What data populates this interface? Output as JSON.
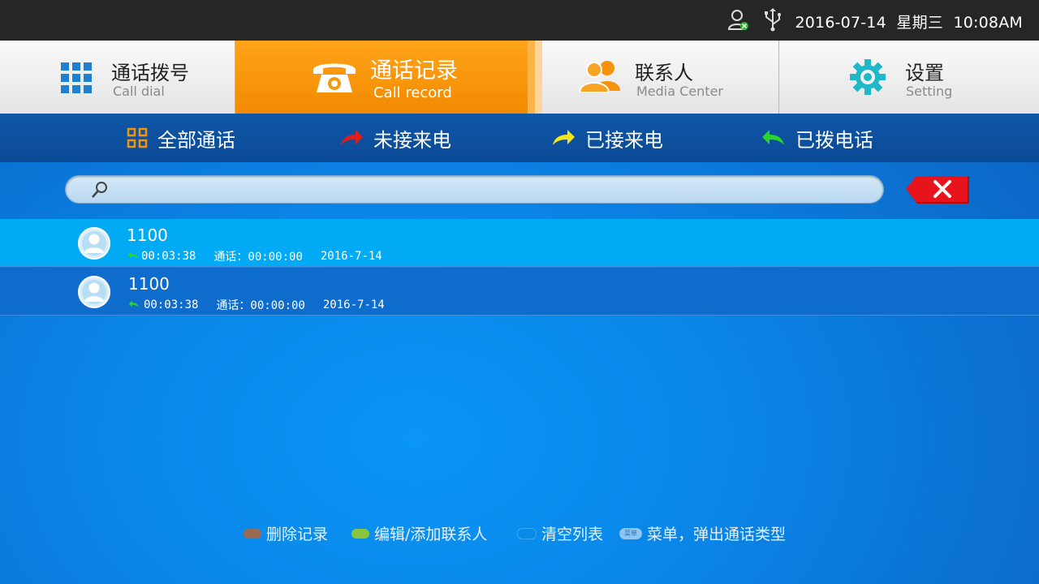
{
  "status": {
    "datetime": "2016-07-14  星期三  10:08AM",
    "icons": [
      "user-status-icon",
      "usb-icon"
    ]
  },
  "tabs": [
    {
      "label": "通话拨号",
      "sub": "Call dial",
      "icon": "dialpad-icon",
      "active": false
    },
    {
      "label": "通话记录",
      "sub": "Call record",
      "icon": "telephone-icon",
      "active": true
    },
    {
      "label": "联系人",
      "sub": "Media Center",
      "icon": "contacts-icon",
      "active": false
    },
    {
      "label": "设置",
      "sub": "Setting",
      "icon": "gear-icon",
      "active": false
    }
  ],
  "filters": [
    {
      "label": "全部通话",
      "icon": "grid-icon"
    },
    {
      "label": "未接来电",
      "icon": "missed-call-arrow-icon"
    },
    {
      "label": "已接来电",
      "icon": "received-call-arrow-icon"
    },
    {
      "label": "已拨电话",
      "icon": "dialed-call-arrow-icon"
    }
  ],
  "search": {
    "value": "",
    "placeholder": ""
  },
  "records": [
    {
      "number": "1100",
      "time": "00:03:38",
      "duration": "通话：00:00:00",
      "date": "2016-7-14",
      "selected": true
    },
    {
      "number": "1100",
      "time": "00:03:38",
      "duration": "通话：00:00:00",
      "date": "2016-7-14",
      "selected": false
    }
  ],
  "hints": [
    {
      "label": "删除记录",
      "color": "#9b6a55"
    },
    {
      "label": "编辑/添加联系人",
      "color": "#8cc63f"
    },
    {
      "label": "清空列表",
      "color": "#0a8be8"
    },
    {
      "label": "菜单，弹出通话类型",
      "badge": "菜单"
    }
  ],
  "colors": {
    "accent": "#f7930a",
    "filter_bar": "#0a4a95",
    "selected_row": "#00aaf5",
    "missed": "#e21b1b",
    "received": "#f5e51a",
    "dialed": "#2bd42b"
  }
}
